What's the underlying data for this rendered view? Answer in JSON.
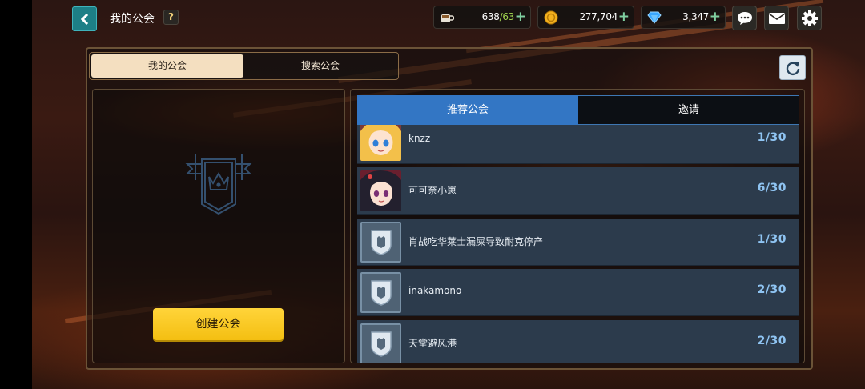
{
  "header": {
    "title": "我的公会",
    "help_label": "?"
  },
  "resources": {
    "stamina": {
      "icon": "coffee-cup-icon",
      "current": "638",
      "max": "/63"
    },
    "gold": {
      "icon": "coin-icon",
      "value": "277,704"
    },
    "gems": {
      "icon": "diamond-icon",
      "value": "3,347"
    },
    "plus_label": "+"
  },
  "tabs": {
    "my_guild": "我的公会",
    "search_guild": "搜索公会"
  },
  "left": {
    "create_button": "创建公会"
  },
  "right": {
    "tab_recommended": "推荐公会",
    "tab_invite": "邀请"
  },
  "guilds": [
    {
      "name": "knzz",
      "count": "1/30",
      "avatar": "blonde-girl-avatar"
    },
    {
      "name": "可可奈小崽",
      "count": "6/30",
      "avatar": "dark-hair-girl-avatar"
    },
    {
      "name": "肖战吃华莱士漏屎导致耐克停产",
      "count": "1/30",
      "avatar": "shield-icon"
    },
    {
      "name": "inakamono",
      "count": "2/30",
      "avatar": "shield-icon"
    },
    {
      "name": "天堂避风港",
      "count": "2/30",
      "avatar": "shield-icon"
    }
  ],
  "colors": {
    "accent_blue": "#3376c4",
    "create_yellow": "#ffd43a",
    "count_blue": "#8fc4f2",
    "teal_back": "#1d7f86"
  }
}
